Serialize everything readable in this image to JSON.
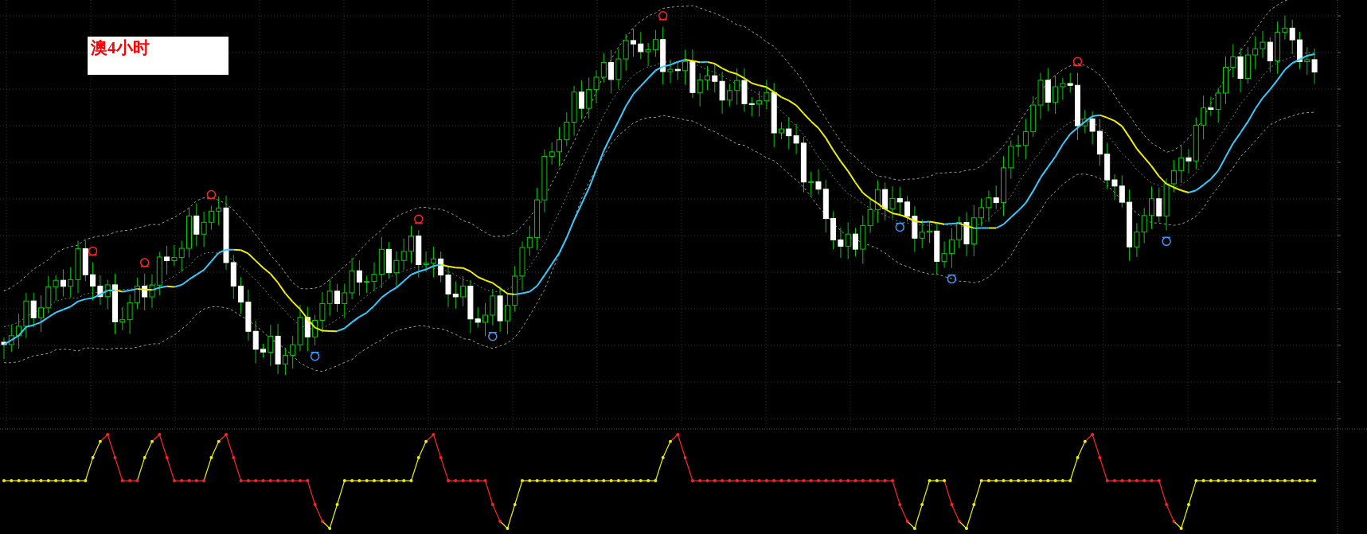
{
  "chart_label": {
    "text": "澳4小时"
  }
}
